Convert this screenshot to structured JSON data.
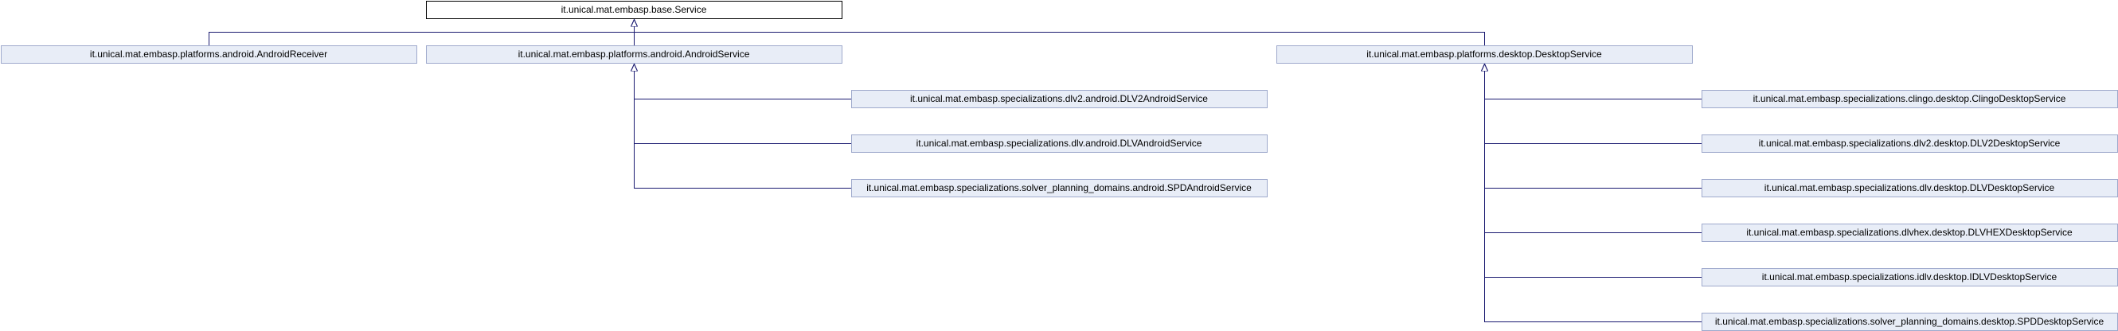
{
  "colors": {
    "edge": "#191970",
    "node_fill": "#e8edf7",
    "node_border": "#9ea9cc",
    "root_fill": "#ffffff",
    "root_border": "#000000",
    "text": "#000000"
  },
  "nodes": {
    "base_service": "it.unical.mat.embasp.base.Service",
    "android_receiver": "it.unical.mat.embasp.platforms.android.AndroidReceiver",
    "android_service": "it.unical.mat.embasp.platforms.android.AndroidService",
    "desktop_service": "it.unical.mat.embasp.platforms.desktop.DesktopService",
    "dlv2_android": "it.unical.mat.embasp.specializations.dlv2.android.DLV2AndroidService",
    "dlv_android": "it.unical.mat.embasp.specializations.dlv.android.DLVAndroidService",
    "spd_android": "it.unical.mat.embasp.specializations.solver_planning_domains.android.SPDAndroidService",
    "clingo_desktop": "it.unical.mat.embasp.specializations.clingo.desktop.ClingoDesktopService",
    "dlv2_desktop": "it.unical.mat.embasp.specializations.dlv2.desktop.DLV2DesktopService",
    "dlv_desktop": "it.unical.mat.embasp.specializations.dlv.desktop.DLVDesktopService",
    "dlvhex_desktop": "it.unical.mat.embasp.specializations.dlvhex.desktop.DLVHEXDesktopService",
    "idlv_desktop": "it.unical.mat.embasp.specializations.idlv.desktop.IDLVDesktopService",
    "spd_desktop": "it.unical.mat.embasp.specializations.solver_planning_domains.desktop.SPDDesktopService"
  }
}
